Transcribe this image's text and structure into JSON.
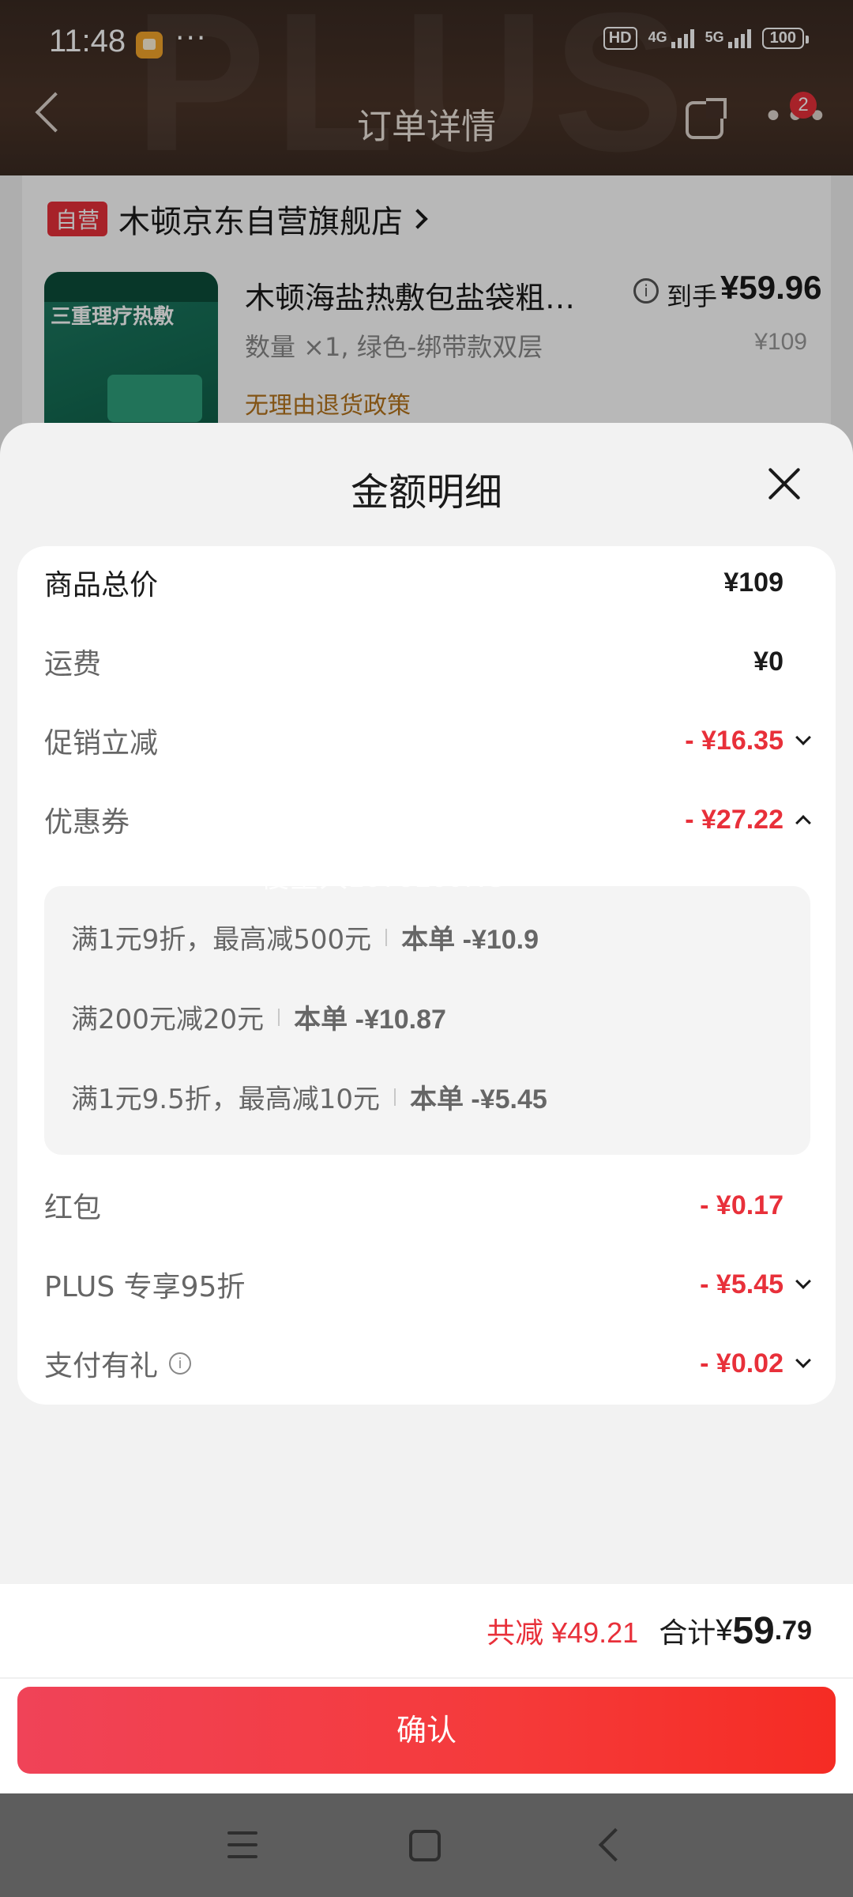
{
  "status_bar": {
    "time": "11:48",
    "dots": "···",
    "hd_badge": "HD",
    "net1": "4G",
    "net2": "5G",
    "battery": "100"
  },
  "header": {
    "title": "订单详情",
    "more_badge": "2",
    "watermark": "PLUS"
  },
  "order": {
    "self_tag": "自营",
    "store_name": "木顿京东自营旗舰店",
    "product_image_text": "三重理疗热敷",
    "product_title": "木顿海盐热敷包盐袋粗…",
    "price_label": "到手",
    "price": "¥59.96",
    "spec": "数量 ×1, 绿色-绑带款双层",
    "original_price": "¥109",
    "policy": "无理由退货政策"
  },
  "sheet": {
    "title": "金额明细",
    "rows": [
      {
        "label": "商品总价",
        "value": "¥109"
      },
      {
        "label": "运费",
        "value": "¥0"
      },
      {
        "label": "促销立减",
        "value": "- ¥16.35"
      },
      {
        "label": "优惠券",
        "value": "- ¥27.22"
      },
      {
        "label": "红包",
        "value": "- ¥0.17"
      },
      {
        "label": "PLUS 专享95折",
        "value": "- ¥5.45"
      },
      {
        "label": "支付有礼",
        "value": "- ¥0.02"
      }
    ],
    "coupons": [
      {
        "desc": "满1元9折，最高减500元",
        "amount": "本单 -¥10.9"
      },
      {
        "desc": "满200元减20元",
        "amount": "本单 -¥10.87"
      },
      {
        "desc": "满1元9.5折，最高减10元",
        "amount": "本单 -¥5.45"
      }
    ],
    "watermark": "慢星人1075109KG",
    "total_reduce": "共减 ¥49.21",
    "total_label": "合计",
    "total_symbol": "¥",
    "total_int": "59",
    "total_dec": ".79",
    "confirm": "确认"
  },
  "colors": {
    "accent_red": "#e8303a",
    "header_brown": "#4a3428",
    "policy_gold": "#b4741d"
  },
  "icons": [
    "back-icon",
    "share-icon",
    "more-icon",
    "info-icon",
    "close-icon",
    "chevron-down-icon",
    "chevron-up-icon",
    "nav-menu-icon",
    "nav-home-icon",
    "nav-back-icon"
  ]
}
